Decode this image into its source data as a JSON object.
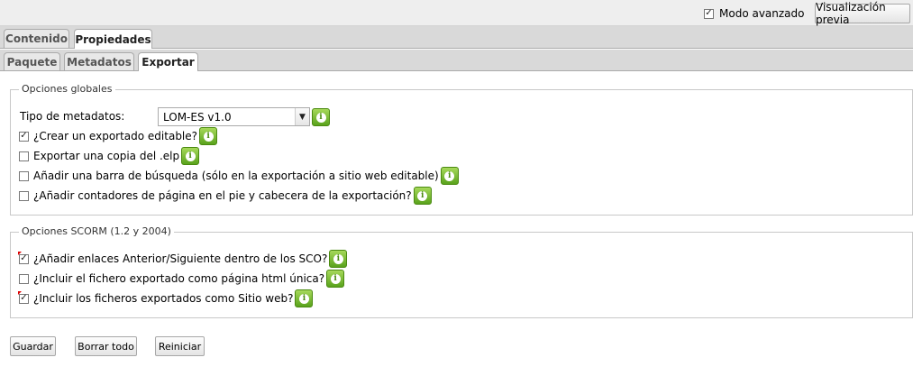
{
  "topbar": {
    "advanced_mode_label": "Modo avanzado",
    "advanced_mode_checked": true,
    "preview_button": "Visualización previa"
  },
  "main_tabs": [
    {
      "label": "Contenido",
      "active": false
    },
    {
      "label": "Propiedades",
      "active": true
    }
  ],
  "sub_tabs": [
    {
      "label": "Paquete",
      "active": false
    },
    {
      "label": "Metadatos",
      "active": false
    },
    {
      "label": "Exportar",
      "active": true
    }
  ],
  "global_options": {
    "legend": "Opciones globales",
    "metadata_type_label": "Tipo de metadatos:",
    "metadata_type_value": "LOM-ES v1.0",
    "options": [
      {
        "label": "¿Crear un exportado editable?",
        "checked": true
      },
      {
        "label": "Exportar una copia del .elp",
        "checked": false
      },
      {
        "label": "Añadir una barra de búsqueda (sólo en la exportación a sitio web editable)",
        "checked": false
      },
      {
        "label": "¿Añadir contadores de página en el pie y cabecera de la exportación?",
        "checked": false
      }
    ]
  },
  "scorm_options": {
    "legend": "Opciones SCORM (1.2 y 2004)",
    "options": [
      {
        "label": "¿Añadir enlaces Anterior/Siguiente dentro de los SCO?",
        "checked": true
      },
      {
        "label": "¿Incluir el fichero exportado como página html única?",
        "checked": false
      },
      {
        "label": "¿Incluir los ficheros exportados como Sitio web?",
        "checked": true
      }
    ]
  },
  "actions": {
    "save": "Guardar",
    "clear_all": "Borrar todo",
    "reset": "Reiniciar"
  },
  "icons": {
    "info": "info-icon",
    "dropdown": "chevron-down-icon"
  },
  "colors": {
    "info_green": "#5aa21c",
    "tab_bar": "#d9d9d9",
    "topbar": "#eeeeee"
  }
}
